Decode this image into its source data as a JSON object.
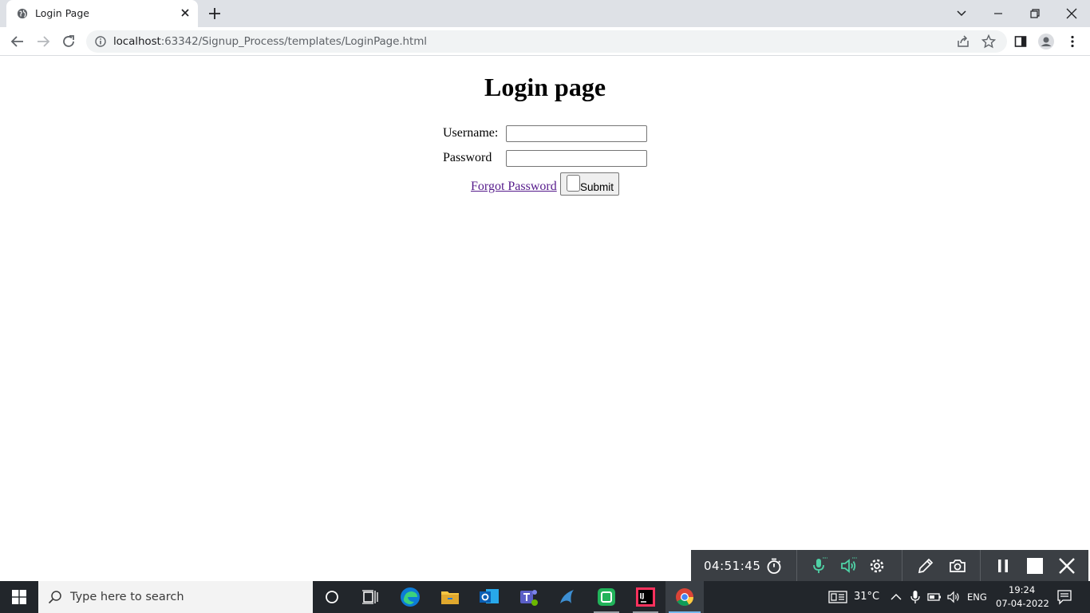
{
  "browser": {
    "tab": {
      "title": "Login Page",
      "favicon": "globe-icon"
    },
    "address": {
      "host": "localhost",
      "path": ":63342/Signup_Process/templates/LoginPage.html"
    }
  },
  "page": {
    "heading": "Login page",
    "username_label": "Username:",
    "username_value": "",
    "password_label": "Password",
    "password_value": "",
    "forgot_link": "Forgot Password",
    "submit_label": "Submit"
  },
  "recorder": {
    "elapsed": "04:51:45"
  },
  "taskbar": {
    "search_placeholder": "Type here to search",
    "weather": "31°C",
    "language": "ENG",
    "time": "19:24",
    "date": "07-04-2022"
  },
  "colors": {
    "tabstrip": "#dee1e6",
    "link_visited": "#551a8b",
    "taskbar": "#22262b",
    "recorder": "#3b3f44",
    "recorder_accent": "#4fd1a5"
  }
}
